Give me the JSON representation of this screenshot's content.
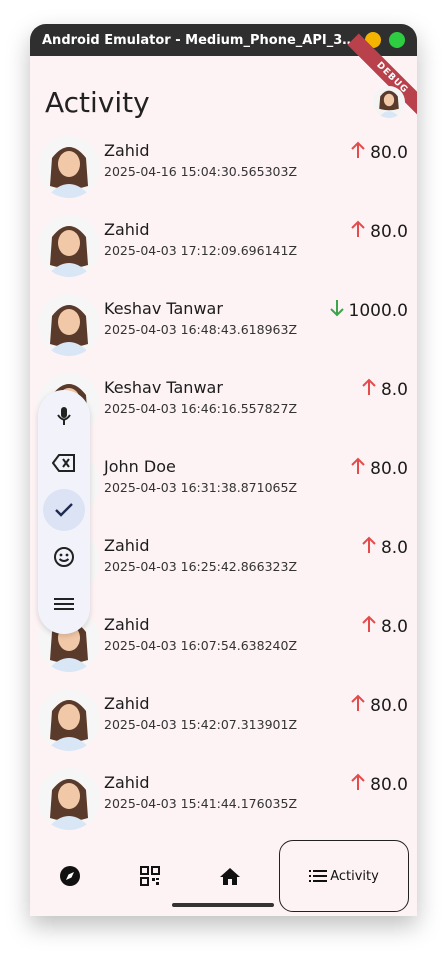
{
  "window": {
    "title": "Android Emulator - Medium_Phone_API_35:...",
    "dot_colors": [
      "#f5b400",
      "#2ecc40"
    ]
  },
  "app": {
    "page_title": "Activity",
    "debug_label": "DEBUG"
  },
  "activities": [
    {
      "name": "Zahid",
      "time": "2025-04-16 15:04:30.565303Z",
      "amount": "80.0",
      "direction": "up"
    },
    {
      "name": "Zahid",
      "time": "2025-04-03 17:12:09.696141Z",
      "amount": "80.0",
      "direction": "up"
    },
    {
      "name": "Keshav Tanwar",
      "time": "2025-04-03 16:48:43.618963Z",
      "amount": "1000.0",
      "direction": "down"
    },
    {
      "name": "Keshav Tanwar",
      "time": "2025-04-03 16:46:16.557827Z",
      "amount": "8.0",
      "direction": "up"
    },
    {
      "name": "John Doe",
      "time": "2025-04-03 16:31:38.871065Z",
      "amount": "80.0",
      "direction": "up"
    },
    {
      "name": "Zahid",
      "time": "2025-04-03 16:25:42.866323Z",
      "amount": "8.0",
      "direction": "up"
    },
    {
      "name": "Zahid",
      "time": "2025-04-03 16:07:54.638240Z",
      "amount": "8.0",
      "direction": "up"
    },
    {
      "name": "Zahid",
      "time": "2025-04-03 15:42:07.313901Z",
      "amount": "80.0",
      "direction": "up"
    },
    {
      "name": "Zahid",
      "time": "2025-04-03 15:41:44.176035Z",
      "amount": "80.0",
      "direction": "up"
    }
  ],
  "colors": {
    "up_arrow": "#e44b4b",
    "down_arrow": "#3ea34a"
  },
  "keyboard_rail": {
    "buttons": [
      "mic-icon",
      "backspace-icon",
      "check-icon",
      "emoji-icon",
      "menu-icon"
    ],
    "active": "check-icon"
  },
  "bottom_nav": {
    "items": [
      "compass-icon",
      "qr-code-icon",
      "home-icon"
    ],
    "activity_label": "Activity"
  }
}
